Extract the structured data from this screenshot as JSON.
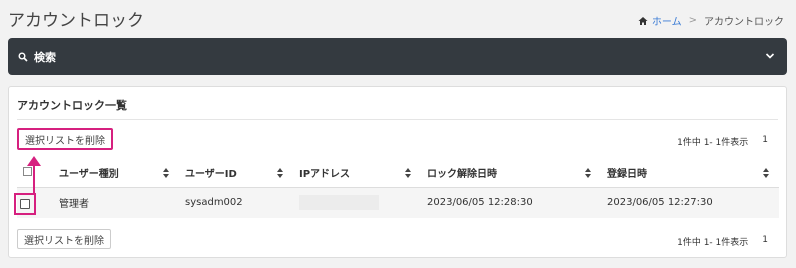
{
  "header": {
    "title": "アカウントロック",
    "breadcrumb": {
      "home": "ホーム",
      "separator": ">",
      "current": "アカウントロック"
    }
  },
  "search": {
    "label": "検索"
  },
  "card": {
    "title": "アカウントロック一覧",
    "delete_button": "選択リストを削除",
    "pager": {
      "summary": "1件中 1- 1件表示",
      "page": "1"
    }
  },
  "table": {
    "columns": [
      "ユーザー種別",
      "ユーザーID",
      "IPアドレス",
      "ロック解除日時",
      "登録日時"
    ],
    "rows": [
      {
        "user_type": "管理者",
        "user_id": "sysadm002",
        "ip": "",
        "unlock_at": "2023/06/05 12:28:30",
        "registered_at": "2023/06/05 12:27:30"
      }
    ]
  },
  "colors": {
    "highlight": "#d6207f",
    "search_bar": "#343a40",
    "link": "#3a7bd5"
  }
}
